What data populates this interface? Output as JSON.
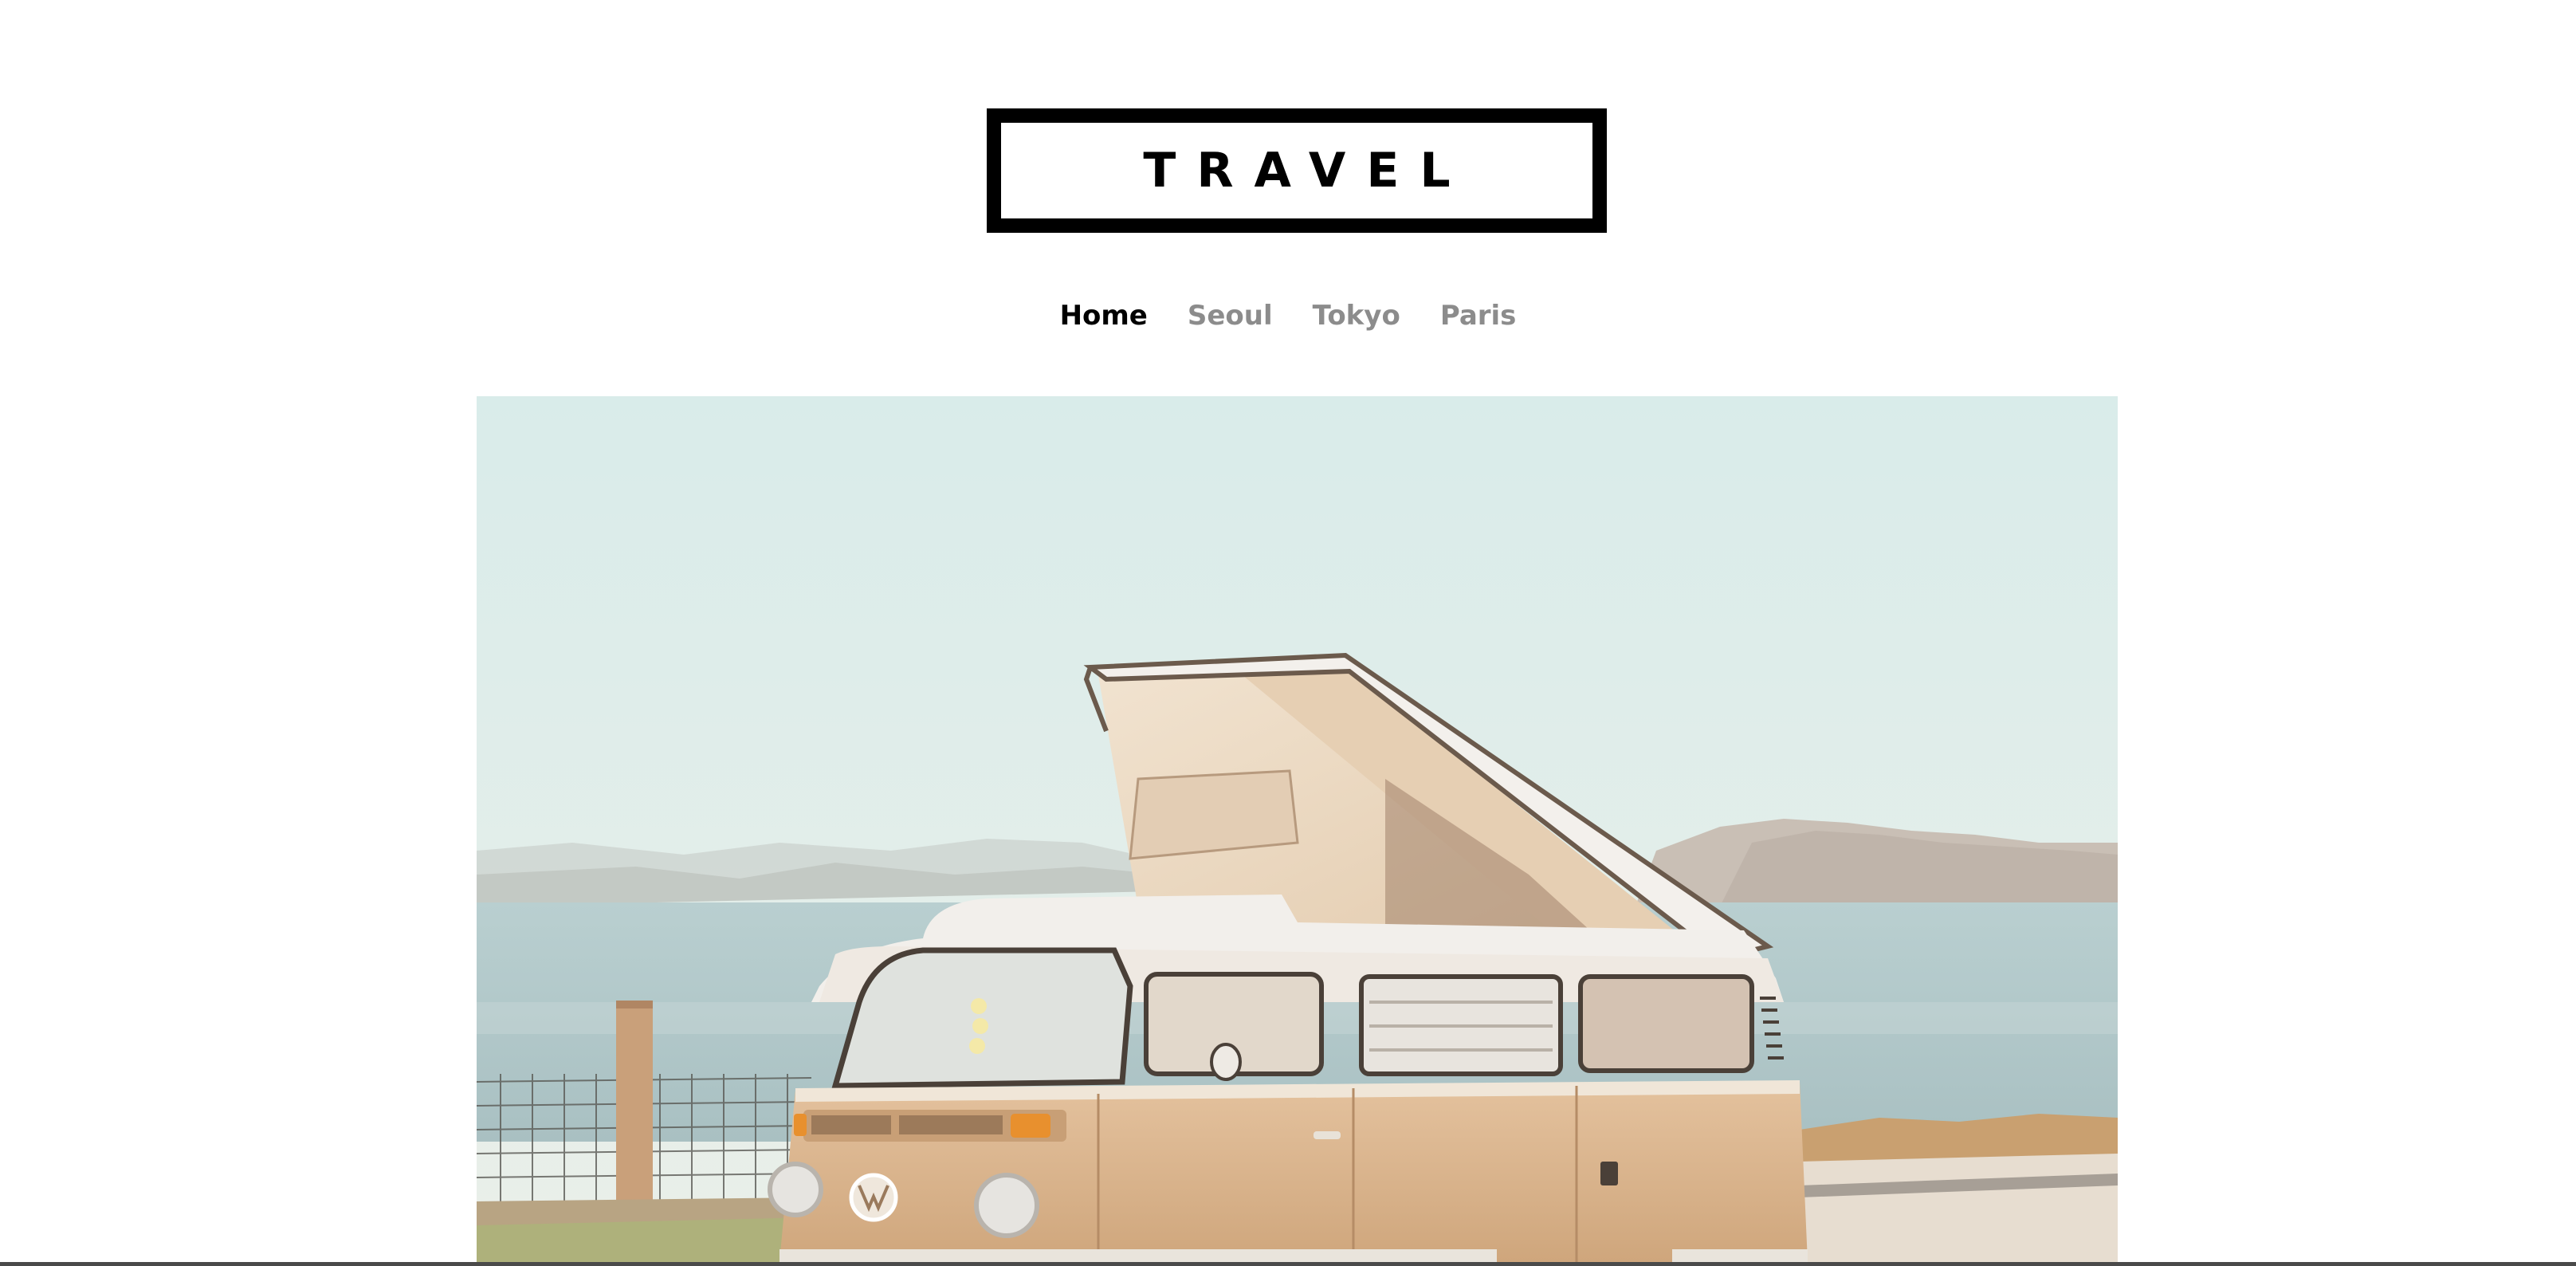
{
  "site": {
    "logo_text": "TRAVEL"
  },
  "nav": {
    "items": [
      {
        "label": "Home",
        "active": true
      },
      {
        "label": "Seoul",
        "active": false
      },
      {
        "label": "Tokyo",
        "active": false
      },
      {
        "label": "Paris",
        "active": false
      }
    ]
  },
  "colors": {
    "active_link": "#000000",
    "inactive_link": "#8c8c8c",
    "sky": "#dcecea",
    "van": "#d8b48e"
  }
}
